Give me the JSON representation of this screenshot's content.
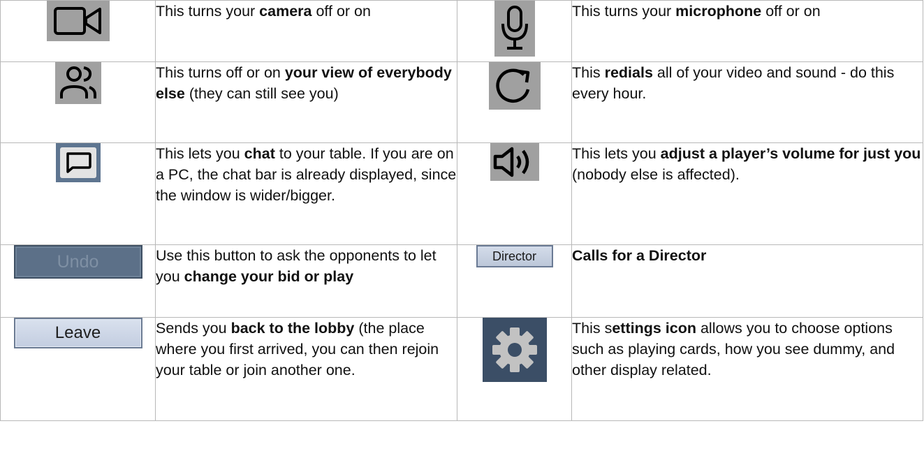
{
  "rows": [
    {
      "left": {
        "icon": "camera-icon",
        "parts": [
          {
            "t": "This turns your ",
            "b": false
          },
          {
            "t": "camera",
            "b": true
          },
          {
            "t": " off or on",
            "b": false
          }
        ]
      },
      "right": {
        "icon": "microphone-icon",
        "parts": [
          {
            "t": "This turns your ",
            "b": false
          },
          {
            "t": "microphone",
            "b": true
          },
          {
            "t": " off or on",
            "b": false
          }
        ]
      }
    },
    {
      "left": {
        "icon": "people-icon",
        "parts": [
          {
            "t": "This turns off or on ",
            "b": false
          },
          {
            "t": "your view of everybody else",
            "b": true
          },
          {
            "t": " (they can still see you)",
            "b": false
          }
        ]
      },
      "right": {
        "icon": "redial-icon",
        "parts": [
          {
            "t": "This ",
            "b": false
          },
          {
            "t": "redials",
            "b": true
          },
          {
            "t": " all of your video and sound  - do this every hour.",
            "b": false
          }
        ]
      }
    },
    {
      "left": {
        "icon": "chat-icon",
        "parts": [
          {
            "t": "This lets you ",
            "b": false
          },
          {
            "t": "chat",
            "b": true
          },
          {
            "t": " to your table. If you are on a PC, the chat bar is already displayed, since the window is wider/bigger.",
            "b": false
          }
        ]
      },
      "right": {
        "icon": "speaker-icon",
        "parts": [
          {
            "t": "This lets you ",
            "b": false
          },
          {
            "t": "adjust a player’s volume for just you",
            "b": true
          },
          {
            "t": "  (nobody else is affected).",
            "b": false
          }
        ]
      }
    },
    {
      "left": {
        "icon": "undo-button-image",
        "button_label": "Undo",
        "parts": [
          {
            "t": "Use this button to ask the opponents to let you ",
            "b": false
          },
          {
            "t": "change your bid or play",
            "b": true
          }
        ]
      },
      "right": {
        "icon": "director-button-image",
        "button_label": "Director",
        "parts": [
          {
            "t": "Calls for a Director",
            "b": true
          }
        ]
      }
    },
    {
      "left": {
        "icon": "leave-button-image",
        "button_label": "Leave",
        "parts": [
          {
            "t": "Sends you ",
            "b": false
          },
          {
            "t": "back to the lobby",
            "b": true
          },
          {
            "t": " (the place where you first arrived, you can then rejoin your table or join another one.",
            "b": false
          }
        ]
      },
      "right": {
        "icon": "gear-icon",
        "parts": [
          {
            "t": "This s",
            "b": false
          },
          {
            "t": "ettings icon",
            "b": true
          },
          {
            "t": " allows you to choose options such as playing cards, how you see dummy, and other display related.",
            "b": false
          }
        ]
      }
    }
  ]
}
